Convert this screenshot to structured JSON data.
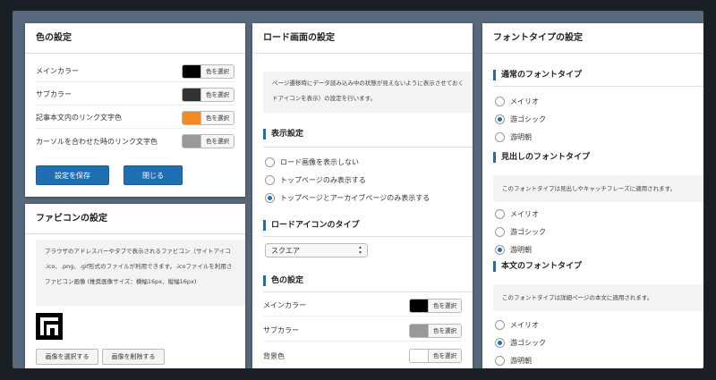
{
  "colors": {
    "black": "#000000",
    "dark": "#333333",
    "orange": "#f28a22",
    "gray": "#999999",
    "white": "#ffffff",
    "accent": "#1f6fb2"
  },
  "color_panel": {
    "title": "色の設定",
    "rows": [
      {
        "label": "メインカラー",
        "picker_label": "色を選択"
      },
      {
        "label": "サブカラー",
        "picker_label": "色を選択"
      },
      {
        "label": "記事本文内のリンク文字色",
        "picker_label": "色を選択"
      },
      {
        "label": "カーソルを合わせた時のリンク文字色",
        "picker_label": "色を選択"
      }
    ],
    "save_label": "設定を保存",
    "close_label": "閉じる"
  },
  "favicon_panel": {
    "title": "ファビコンの設定",
    "desc1": "ブラウザのアドレスバーやタブで表示されるファビコン（サイトアイコ",
    "desc2": ".ico、.png、.gif形式のファイルが利用できます。.icoファイルを利用さ",
    "size_note": "ファビコン画像 (推奨画像サイズ：横幅16px、縦幅16px)",
    "select_label": "画像を選択する",
    "delete_label": "画像を削除する"
  },
  "load_panel": {
    "title": "ロード画面の設定",
    "desc1": "ページ遷移時にデータ読み込み中の状態が見えないように表示させておく",
    "desc2": "ドアイコンを表示）の設定を行います。",
    "display_title": "表示設定",
    "display_options": [
      "ロード画像を表示しない",
      "トップページのみ表示する",
      "トップページとアーカイブページのみ表示する"
    ],
    "icon_type_title": "ロードアイコンのタイプ",
    "icon_type_value": "スクエア",
    "color_title": "色の設定",
    "color_rows": [
      {
        "label": "メインカラー",
        "picker_label": "色を選択"
      },
      {
        "label": "サブカラー",
        "picker_label": "色を選択"
      },
      {
        "label": "背景色",
        "picker_label": "色を選択"
      }
    ]
  },
  "font_panel": {
    "title": "フォントタイプの設定",
    "normal_title": "通常のフォントタイプ",
    "heading_title": "見出しのフォントタイプ",
    "heading_desc": "このフォントタイプは見出しやキャッチフレーズに適用されます。",
    "body_title": "本文のフォントタイプ",
    "body_desc": "このフォントタイプは詳細ページの本文に適用されます。",
    "options": [
      "メイリオ",
      "游ゴシック",
      "游明朝"
    ]
  }
}
